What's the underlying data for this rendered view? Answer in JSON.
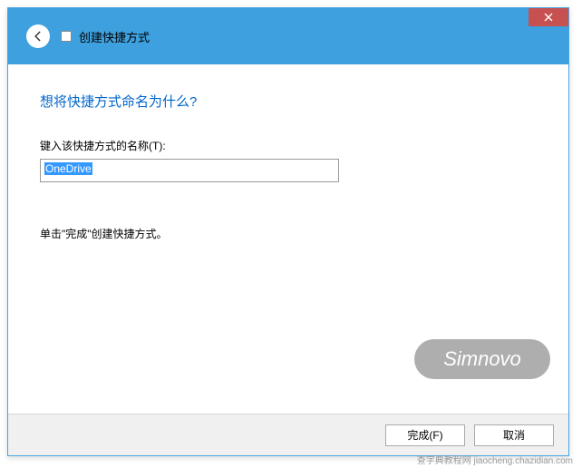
{
  "titlebar": {
    "title": "创建快捷方式"
  },
  "content": {
    "heading": "想将快捷方式命名为什么?",
    "input_label": "键入该快捷方式的名称(T):",
    "input_value": "OneDrive",
    "instruction": "单击\"完成\"创建快捷方式。"
  },
  "footer": {
    "finish_label": "完成(F)",
    "cancel_label": "取消"
  },
  "watermark": {
    "text": "Simnovo"
  },
  "footer_note": "查字典教程网 jiaocheng.chazidian.com"
}
